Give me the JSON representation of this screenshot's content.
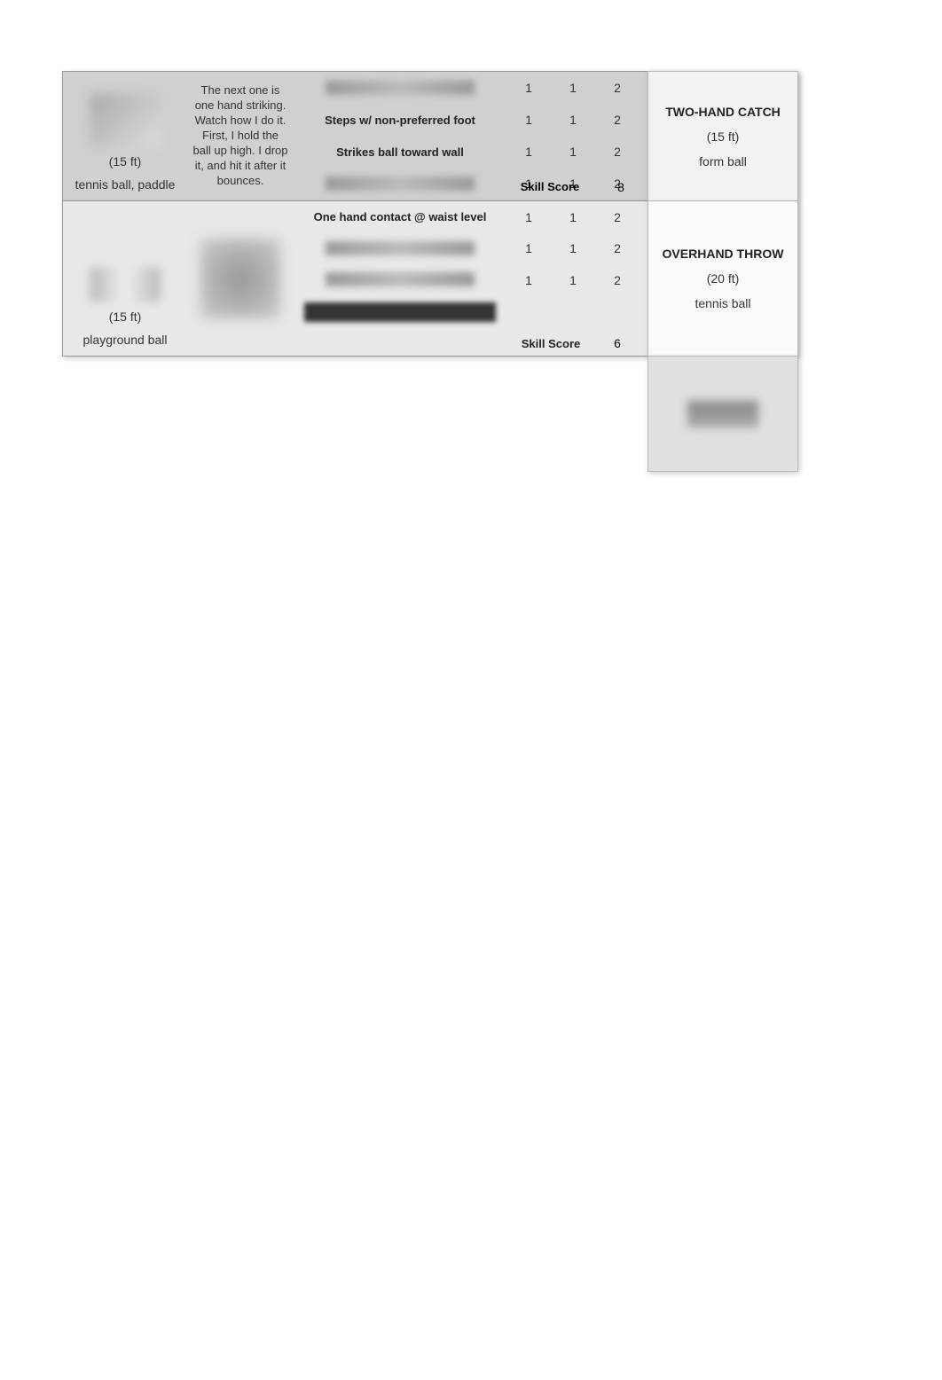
{
  "section1": {
    "left": {
      "distance": "(15 ft)",
      "equipment": "tennis ball, paddle"
    },
    "description": "The next one is one hand striking. Watch how I do it. First, I hold the ball up high. I drop it, and hit it after it bounces.",
    "criteria": [
      "",
      "Steps w/ non-preferred foot",
      "Strikes ball toward wall",
      ""
    ],
    "scores": [
      {
        "t1": "1",
        "t2": "1",
        "total": "2"
      },
      {
        "t1": "1",
        "t2": "1",
        "total": "2"
      },
      {
        "t1": "1",
        "t2": "1",
        "total": "2"
      },
      {
        "t1": "1",
        "t2": "1",
        "total": "2"
      }
    ],
    "skillScoreLabel": "Skill Score",
    "skillScoreTotal": "8",
    "right": {
      "title": "TWO-HAND CATCH",
      "distance": "(15 ft)",
      "equipment": "form ball"
    }
  },
  "section2": {
    "left": {
      "distance": "(15 ft)",
      "equipment": "playground ball"
    },
    "criteria": [
      "One hand contact @ waist level",
      "",
      "",
      ""
    ],
    "scores": [
      {
        "t1": "1",
        "t2": "1",
        "total": "2"
      },
      {
        "t1": "1",
        "t2": "1",
        "total": "2"
      },
      {
        "t1": "1",
        "t2": "1",
        "total": "2"
      },
      {
        "t1": "",
        "t2": "",
        "total": ""
      }
    ],
    "skillScoreLabel": "Skill Score",
    "skillScoreTotal": "6",
    "right": {
      "title": "OVERHAND THROW",
      "distance": "(20 ft)",
      "equipment": "tennis ball"
    }
  }
}
